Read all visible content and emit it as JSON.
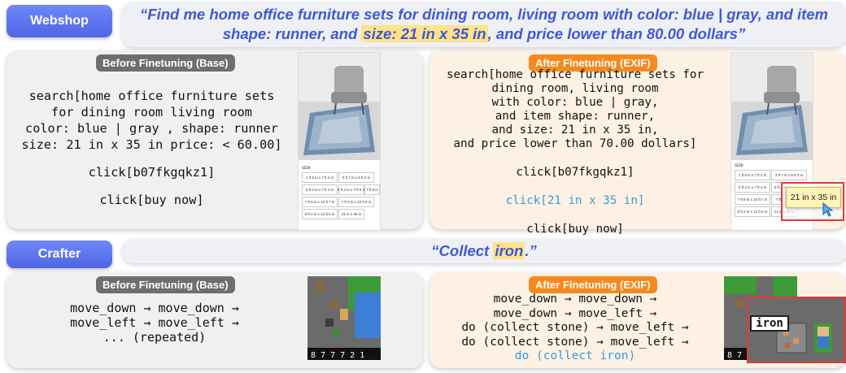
{
  "webshop": {
    "tag": "Webshop",
    "task_before": "“Find me home office furniture sets for dining room, living room with color: blue | gray, and item",
    "task_line2_pre": "shape: runner, and ",
    "task_line2_hl": "size: 21 in x 35 in",
    "task_line2_post": ", and price lower than 80.00 dollars”",
    "base": {
      "pill": "Before Finetuning (Base)",
      "lines": [
        "search[home office furniture sets",
        "for dining room living room",
        "color: blue | gray , shape: runner",
        "size: 21 in x 35 in price: < 60.00]",
        "",
        "click[b07fkgqkz1]",
        "",
        "click[buy now]"
      ],
      "size_label": "size",
      "sizes": [
        "1 ft 9 in x 7 ft 2 in",
        "3 ft 7 in x 5 ft 2 in",
        "5 ft 2 in x 7 ft 4 in",
        "5 ft 3 in x 7 ft 5 in",
        "7 ft 9 in",
        "7 ft 8 in x 10 ft 7 in",
        "7 ft 9 in x 10 ft 8 in",
        "9 ft 2 in x 12 ft 5 in",
        "21 in x 35 in"
      ]
    },
    "ft": {
      "pill": "After Finetuning (EXIF)",
      "lines": [
        "search[home office furniture sets for",
        "dining room, living room",
        "with color: blue | gray,",
        "and item shape: runner,",
        "and size: 21 in x 35 in,",
        "and price lower than 70.00 dollars]",
        "",
        "click[b07fkgqkz1]",
        ""
      ],
      "click_size": "click[21 in x 35 in]",
      "buy": "click[buy now]",
      "zoom_label": "21 in x 35 in",
      "size_label": "size",
      "sizes": [
        "1 ft 9 in x 7 ft 2 in",
        "3 ft 7 in x 5 ft 2 in",
        "5 ft 2 in x 7 ft 4 in",
        "5 ft 3 in",
        "7 ft 8 in x 10 ft 7 in",
        "7 ft",
        "9 ft 2 in x 12 ft 5 in",
        "21 in x 35 in"
      ]
    }
  },
  "crafter": {
    "tag": "Crafter",
    "task_pre": "“Collect ",
    "task_hl": "iron",
    "task_post": ".”",
    "base": {
      "pill": "Before Finetuning (Base)",
      "lines": [
        "move_down → move_down →",
        "move_left → move_left →",
        "... (repeated)"
      ],
      "hud": "8 7 7 7   2 1"
    },
    "ft": {
      "pill": "After Finetuning (EXIF)",
      "lines": [
        "move_down → move_down →",
        "move_down → move_left →",
        "do (collect stone) → move_left →",
        "do (collect stone) → move_left →"
      ],
      "last": "do (collect iron)",
      "zoom_label": "iron",
      "hud": "8 7 6 7"
    }
  },
  "colors": {
    "accent": "#3f58d6",
    "orange": "#f5891f",
    "highlight": "#ffe28a",
    "zoom_box": "#e53935",
    "blue_text": "#3a9ad9"
  }
}
